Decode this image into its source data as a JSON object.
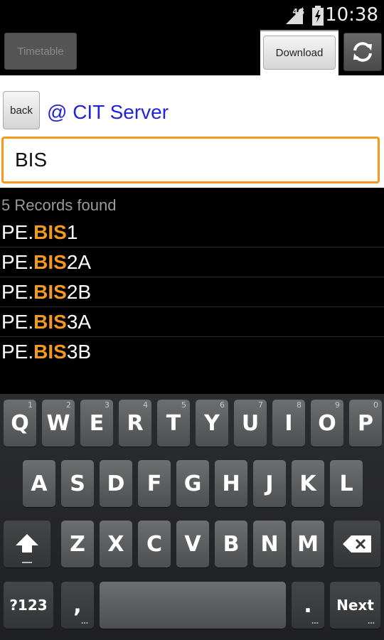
{
  "status_bar": {
    "network": "4G",
    "time": "10:38"
  },
  "toolbar": {
    "timetable_label": "Timetable",
    "download_label": "Download",
    "refresh_icon": "refresh-icon"
  },
  "header": {
    "back_label": "back",
    "server_label": "@ CIT Server"
  },
  "search": {
    "value": "BIS"
  },
  "results": {
    "count_text": "5 Records found",
    "items": [
      {
        "prefix": "PE.",
        "match": "BIS",
        "suffix": "1"
      },
      {
        "prefix": "PE.",
        "match": "BIS",
        "suffix": "2A"
      },
      {
        "prefix": "PE.",
        "match": "BIS",
        "suffix": "2B"
      },
      {
        "prefix": "PE.",
        "match": "BIS",
        "suffix": "3A"
      },
      {
        "prefix": "PE.",
        "match": "BIS",
        "suffix": "3B"
      }
    ]
  },
  "keyboard": {
    "row1": [
      {
        "label": "Q",
        "hint": "1"
      },
      {
        "label": "W",
        "hint": "2"
      },
      {
        "label": "E",
        "hint": "3"
      },
      {
        "label": "R",
        "hint": "4"
      },
      {
        "label": "T",
        "hint": "5"
      },
      {
        "label": "Y",
        "hint": "6"
      },
      {
        "label": "U",
        "hint": "7"
      },
      {
        "label": "I",
        "hint": "8"
      },
      {
        "label": "O",
        "hint": "9"
      },
      {
        "label": "P",
        "hint": "0"
      }
    ],
    "row2": [
      "A",
      "S",
      "D",
      "F",
      "G",
      "H",
      "J",
      "K",
      "L"
    ],
    "row3": [
      "Z",
      "X",
      "C",
      "V",
      "B",
      "N",
      "M"
    ],
    "symbols_label": "?123",
    "comma_label": ",",
    "period_label": ".",
    "next_label": "Next"
  },
  "colors": {
    "accent": "#f39a1c",
    "server_text": "#2222dd"
  }
}
